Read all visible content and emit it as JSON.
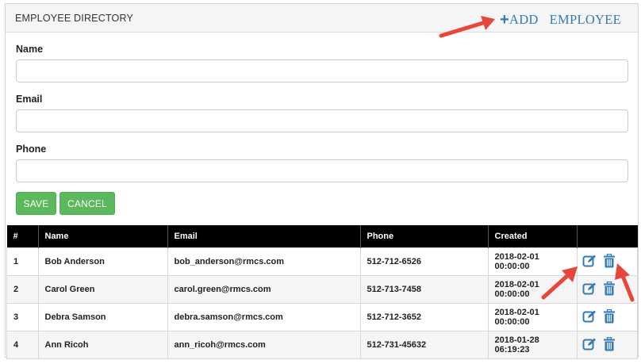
{
  "panel": {
    "title": "EMPLOYEE DIRECTORY",
    "add_icon": "plus-icon",
    "add_label": "ADD",
    "add_label2": "EMPLOYEE"
  },
  "form": {
    "name_label": "Name",
    "name_value": "",
    "email_label": "Email",
    "email_value": "",
    "phone_label": "Phone",
    "phone_value": "",
    "save_label": "SAVE",
    "cancel_label": "CANCEL"
  },
  "table": {
    "headers": [
      "#",
      "Name",
      "Email",
      "Phone",
      "Created",
      ""
    ],
    "rows": [
      {
        "id": "1",
        "name": "Bob Anderson",
        "email": "bob_anderson@rmcs.com",
        "phone": "512-712-6526",
        "created": "2018-02-01 00:00:00"
      },
      {
        "id": "2",
        "name": "Carol Green",
        "email": "carol.green@rmcs.com",
        "phone": "512-713-7458",
        "created": "2018-02-01 00:00:00"
      },
      {
        "id": "3",
        "name": "Debra Samson",
        "email": "debra.samson@rmcs.com",
        "phone": "512-712-3652",
        "created": "2018-02-01 00:00:00"
      },
      {
        "id": "4",
        "name": "Ann Ricoh",
        "email": "ann_ricoh@rmcs.com",
        "phone": "512-731-45632",
        "created": "2018-01-28 06:19:23"
      }
    ],
    "row_actions": [
      "edit-icon",
      "trash-icon"
    ]
  },
  "colors": {
    "accent": "#337ab7",
    "button_green": "#5cb85c",
    "header_black": "#000000",
    "annotation_arrow": "#e8453c"
  }
}
